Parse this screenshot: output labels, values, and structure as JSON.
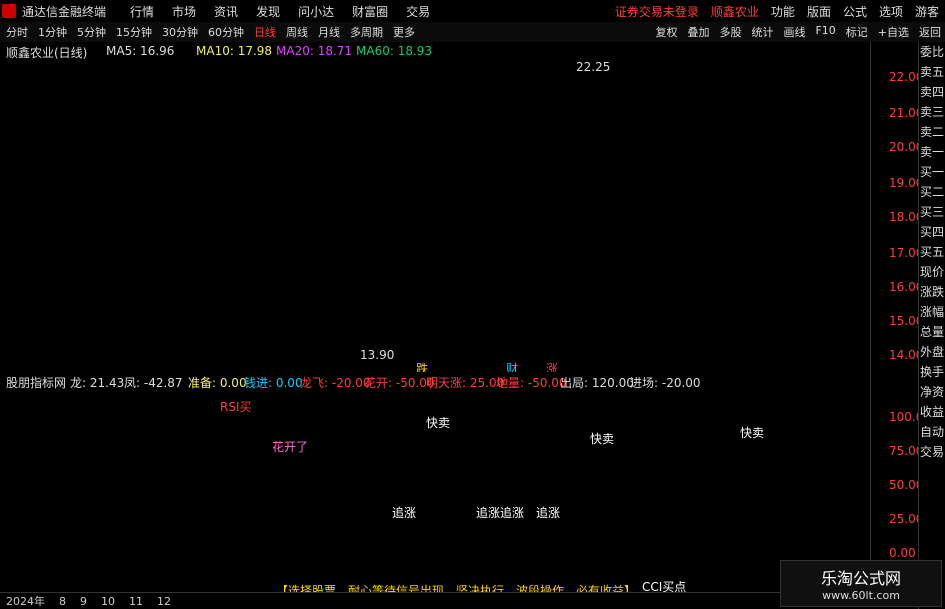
{
  "app": {
    "title": "通达信金融终端",
    "menu": [
      "行情",
      "市场",
      "资讯",
      "发现",
      "问小达",
      "财富圈",
      "交易"
    ],
    "status_red": "证券交易未登录",
    "stock_name": "顺鑫农业",
    "right_menu": [
      "功能",
      "版面",
      "公式",
      "选项"
    ],
    "user": "游客"
  },
  "toolbar": {
    "periods": [
      "分时",
      "1分钟",
      "5分钟",
      "15分钟",
      "30分钟",
      "60分钟",
      "日线",
      "周线",
      "月线",
      "多周期",
      "更多"
    ],
    "active": "日线",
    "tools": [
      "复权",
      "叠加",
      "多股",
      "统计",
      "画线",
      "F10",
      "标记",
      "+自选",
      "返回"
    ]
  },
  "candle": {
    "header": "顺鑫农业(日线)",
    "ma": {
      "ma5": "MA5: 16.96",
      "ma10": "MA10: 17.98",
      "ma20": "MA20: 18.71",
      "ma60": "MA60: 18.93"
    },
    "annotations": {
      "high": "22.25",
      "low": "13.90",
      "buy1": "跌",
      "buy2": "财",
      "buy3": "涨"
    },
    "y_ticks": [
      "22.00",
      "21.00",
      "20.00",
      "19.00",
      "18.00",
      "17.00",
      "16.00",
      "15.00",
      "14.00"
    ]
  },
  "indicator": {
    "header": "股朋指标网",
    "vals": [
      "龙: 21.43",
      "凤: -42.87",
      "准备: 0.00",
      "钱进: 0.00",
      "龙飞: -20.00",
      "花开: -50.00",
      "明天涨: 25.00",
      "地量: -50.00",
      "出局: 120.00",
      "进场: -20.00"
    ],
    "y_ticks": [
      "100.0",
      "75.00",
      "50.00",
      "25.00",
      "0.00"
    ],
    "notes": [
      "RSI买",
      "花开了",
      "快卖",
      "快卖",
      "快卖",
      "追涨",
      "追涨",
      "追涨",
      "追涨",
      "CCI买点"
    ],
    "bottom_banner": "【选择股票，耐心等待信号出现，坚决执行，波段操作，必有收益】"
  },
  "right_panel": [
    "委比",
    "卖五",
    "卖四",
    "卖三",
    "卖二",
    "卖一",
    "买一",
    "买二",
    "买三",
    "买四",
    "买五",
    "现价",
    "涨跌",
    "涨幅",
    "总量",
    "外盘",
    "换手",
    "净资",
    "收益",
    "自动",
    "交易"
  ],
  "bottom": {
    "dates": [
      "2024年",
      "8",
      "9",
      "10",
      "11",
      "12"
    ]
  },
  "watermark": {
    "line1": "乐淘公式网",
    "line2": "www.60lt.com"
  }
}
